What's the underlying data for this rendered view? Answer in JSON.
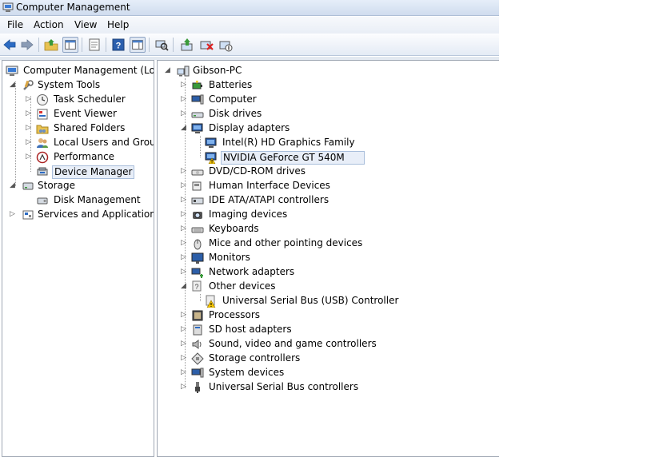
{
  "window": {
    "title": "Computer Management"
  },
  "menu": [
    "File",
    "Action",
    "View",
    "Help"
  ],
  "toolbar": {
    "icons": [
      "back-arrow-icon",
      "forward-arrow-icon",
      "up-folder-icon",
      "show-hide-tree-icon",
      "properties-icon",
      "help-icon",
      "show-hide-action-pane-icon",
      "scan-hardware-icon",
      "update-driver-icon",
      "uninstall-icon",
      "disable-device-icon"
    ]
  },
  "left_tree": {
    "root": "Computer Management (Local",
    "system_tools": "System Tools",
    "task_scheduler": "Task Scheduler",
    "event_viewer": "Event Viewer",
    "shared_folders": "Shared Folders",
    "local_users": "Local Users and Groups",
    "performance": "Performance",
    "device_manager": "Device Manager",
    "storage": "Storage",
    "disk_management": "Disk Management",
    "services_apps": "Services and Applications"
  },
  "device_tree": {
    "computer_name": "Gibson-PC",
    "categories": [
      {
        "label": "Batteries"
      },
      {
        "label": "Computer"
      },
      {
        "label": "Disk drives"
      },
      {
        "label": "Display adapters"
      },
      {
        "label": "DVD/CD-ROM drives"
      },
      {
        "label": "Human Interface Devices"
      },
      {
        "label": "IDE ATA/ATAPI controllers"
      },
      {
        "label": "Imaging devices"
      },
      {
        "label": "Keyboards"
      },
      {
        "label": "Mice and other pointing devices"
      },
      {
        "label": "Monitors"
      },
      {
        "label": "Network adapters"
      },
      {
        "label": "Other devices"
      },
      {
        "label": "Processors"
      },
      {
        "label": "SD host adapters"
      },
      {
        "label": "Sound, video and game controllers"
      },
      {
        "label": "Storage controllers"
      },
      {
        "label": "System devices"
      },
      {
        "label": "Universal Serial Bus controllers"
      }
    ],
    "display_children": [
      "Intel(R) HD Graphics Family",
      "NVIDIA GeForce GT 540M"
    ],
    "other_children": [
      "Universal Serial Bus (USB) Controller"
    ]
  },
  "colors": {
    "selection": "#e8eef8",
    "warning": "#f5c400",
    "toolbar_blue": "#2b6bc4"
  }
}
